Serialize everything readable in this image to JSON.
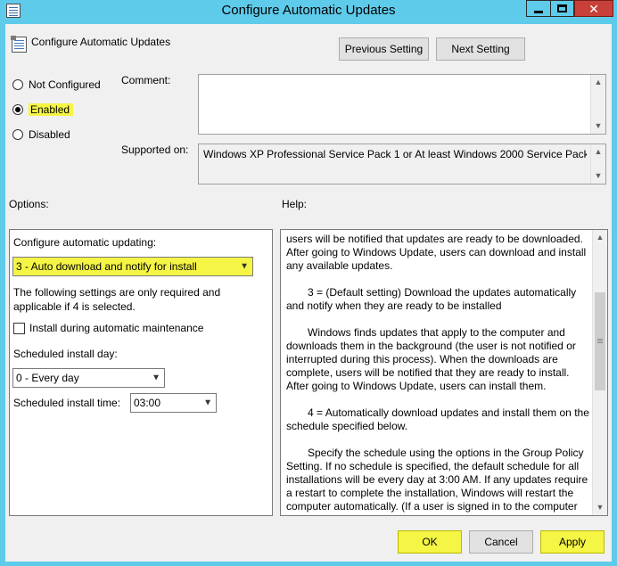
{
  "window": {
    "title": "Configure Automatic Updates",
    "minimize_glyph": "—",
    "close_glyph": "✕"
  },
  "header": {
    "setting_name": "Configure Automatic Updates",
    "previous_label": "Previous Setting",
    "next_label": "Next Setting"
  },
  "state": {
    "not_configured": "Not Configured",
    "enabled": "Enabled",
    "disabled": "Disabled",
    "selected": "Enabled"
  },
  "comment": {
    "label": "Comment:",
    "value": ""
  },
  "supported": {
    "label": "Supported on:",
    "value": "Windows XP Professional Service Pack 1 or At least Windows 2000 Service Pack 3"
  },
  "options": {
    "section_label": "Options:",
    "configure_label": "Configure automatic updating:",
    "configure_value": "3 - Auto download and notify for install",
    "note": "The following settings are only required and applicable if 4 is selected.",
    "maintenance_label": "Install during automatic maintenance",
    "maintenance_checked": false,
    "day_label": "Scheduled install day:",
    "day_value": "0 - Every day",
    "time_label": "Scheduled install time:",
    "time_value": "03:00"
  },
  "help": {
    "section_label": "Help:",
    "paragraphs": [
      "users will be notified that updates are ready to be downloaded. After going to Windows Update, users can download and install any available updates.",
      "3 = (Default setting) Download the updates automatically and notify when they are ready to be installed",
      "Windows finds updates that apply to the computer and downloads them in the background (the user is not notified or interrupted during this process). When the downloads are complete, users will be notified that they are ready to install. After going to Windows Update, users can install them.",
      "4 = Automatically download updates and install them on the schedule specified below.",
      "Specify the schedule using the options in the Group Policy Setting. If no schedule is specified, the default schedule for all installations will be every day at 3:00 AM. If any updates require a restart to complete the installation, Windows will restart the computer automatically. (If a user is signed in to the computer"
    ]
  },
  "footer": {
    "ok_label": "OK",
    "cancel_label": "Cancel",
    "apply_label": "Apply"
  },
  "colors": {
    "titlebar": "#5fcbea",
    "highlight": "#f5f545",
    "close_button": "#c7403a",
    "client_bg": "#f0f0f0"
  }
}
